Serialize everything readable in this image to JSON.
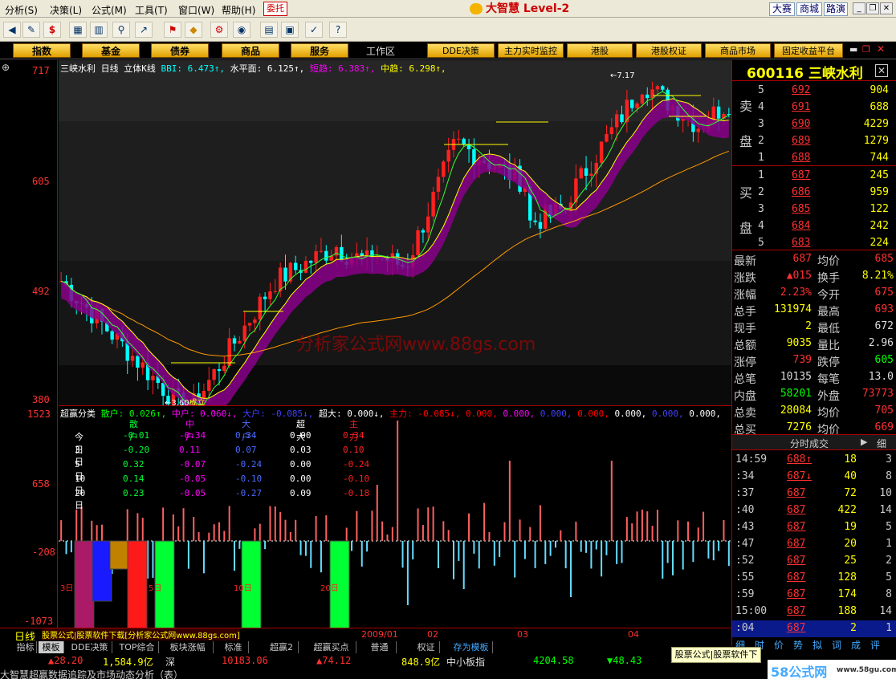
{
  "menu": [
    "分析(S)",
    "决策(L)",
    "公式(M)",
    "工具(T)",
    "窗口(W)",
    "帮助(H)"
  ],
  "menu_red": "委托",
  "brand": "大智慧 Level-2",
  "top_right": [
    "大赛",
    "商城",
    "路演"
  ],
  "toolbar_icons": [
    "mail-icon",
    "dollar-icon",
    "grid-icon",
    "chart-icon",
    "binoculars-icon",
    "bars-icon",
    "tag-icon",
    "diamond-icon",
    "gear-icon",
    "globe-icon",
    "doc-icon",
    "table-icon",
    "check-icon",
    "help-icon"
  ],
  "funcbar": {
    "tabs": [
      "指数",
      "基金",
      "债券",
      "商品",
      "服务"
    ],
    "workzone": "工作区",
    "tabs2": [
      "DDE决策",
      "主力实时监控",
      "港股",
      "港股权证",
      "商品市场",
      "固定收益平台"
    ]
  },
  "chart": {
    "title": "三峡水利",
    "period": "日线",
    "mode": "立体K线",
    "indicators": [
      {
        "label": "BBI: 6.473↑,",
        "color": "#00ffff"
      },
      {
        "label": "水平面: 6.125↑,",
        "color": "#ffffff"
      },
      {
        "label": "短趋: 6.383↑,",
        "color": "#ff00ff"
      },
      {
        "label": "中趋: 6.298↑,",
        "color": "#ffff00"
      }
    ],
    "ylabels": [
      "717",
      "605",
      "492",
      "380"
    ],
    "peak_label": "7.17",
    "low_label": "3.60",
    "low_suffix": "成立",
    "watermark": "分析家公式网www.88gs.com"
  },
  "sub": {
    "title": "超赢分类",
    "legend": [
      {
        "label": "散户: 0.026↑,",
        "color": "#00ff00"
      },
      {
        "label": "中户: 0.060↓,",
        "color": "#ff00ff"
      },
      {
        "label": "大户: -0.085↓,",
        "color": "#4040ff"
      },
      {
        "label": "超大: 0.000↓,",
        "color": "#ffffff"
      },
      {
        "label": "主力: -0.085↓,",
        "color": "#ff0000"
      },
      {
        "label": "0.000,",
        "color": "#ff0000"
      },
      {
        "label": "0.000,",
        "color": "#ff00ff"
      },
      {
        "label": "0.000,",
        "color": "#4040ff"
      },
      {
        "label": "0.000,",
        "color": "#ff0000"
      },
      {
        "label": "0.000,",
        "color": "#ffffff"
      },
      {
        "label": "0.000,",
        "color": "#4040ff"
      },
      {
        "label": "0.000,",
        "color": "#ffffff"
      }
    ],
    "ylabels": [
      "1523",
      "658",
      "-208",
      "-1073"
    ],
    "table_headers": [
      "散户",
      "中户",
      "大户",
      "超大",
      "主力"
    ],
    "table_rows": [
      {
        "label": "今日",
        "vals": [
          "-0.01",
          "-0.34",
          "0.34",
          "0.00",
          "0.34"
        ]
      },
      {
        "label": "3日",
        "vals": [
          "-0.20",
          "0.11",
          "0.07",
          "0.03",
          "0.10"
        ]
      },
      {
        "label": "5日",
        "vals": [
          "0.32",
          "-0.07",
          "-0.24",
          "0.00",
          "-0.24"
        ]
      },
      {
        "label": "10日",
        "vals": [
          "0.14",
          "-0.05",
          "-0.10",
          "0.00",
          "-0.10"
        ]
      },
      {
        "label": "20日",
        "vals": [
          "0.23",
          "-0.05",
          "-0.27",
          "0.09",
          "-0.18"
        ]
      }
    ],
    "group_labels": [
      "3日",
      "5日",
      "10日",
      "20日"
    ]
  },
  "xaxis": {
    "period": "日线",
    "ad": "股票公式|股票软件下载[分析家公式网www.88gs.com]",
    "dates": [
      "2009/01",
      "02",
      "03",
      "04"
    ]
  },
  "quote": {
    "code": "600116",
    "name": "三峡水利",
    "sell_label": [
      "卖",
      "盘"
    ],
    "buy_label": [
      "买",
      "盘"
    ],
    "sell": [
      {
        "lv": "5",
        "p": "692",
        "v": "904"
      },
      {
        "lv": "4",
        "p": "691",
        "v": "688"
      },
      {
        "lv": "3",
        "p": "690",
        "v": "4229"
      },
      {
        "lv": "2",
        "p": "689",
        "v": "1279"
      },
      {
        "lv": "1",
        "p": "688",
        "v": "744"
      }
    ],
    "buy": [
      {
        "lv": "1",
        "p": "687",
        "v": "245"
      },
      {
        "lv": "2",
        "p": "686",
        "v": "959"
      },
      {
        "lv": "3",
        "p": "685",
        "v": "122"
      },
      {
        "lv": "4",
        "p": "684",
        "v": "242"
      },
      {
        "lv": "5",
        "p": "683",
        "v": "224"
      }
    ],
    "info": [
      {
        "l1": "最新",
        "v1": "687",
        "c1": "#ff3030",
        "l2": "均价",
        "v2": "685",
        "c2": "#ff3030"
      },
      {
        "l1": "涨跌",
        "v1": "▲015",
        "c1": "#ff3030",
        "l2": "换手",
        "v2": "8.21%",
        "c2": "#ffff00"
      },
      {
        "l1": "涨幅",
        "v1": "2.23%",
        "c1": "#ff3030",
        "l2": "今开",
        "v2": "675",
        "c2": "#ff3030"
      },
      {
        "l1": "总手",
        "v1": "131974",
        "c1": "#ffff00",
        "l2": "最高",
        "v2": "693",
        "c2": "#ff3030"
      },
      {
        "l1": "现手",
        "v1": "2",
        "c1": "#ffff00",
        "l2": "最低",
        "v2": "672",
        "c2": "#dddddd"
      },
      {
        "l1": "总额",
        "v1": "9035",
        "c1": "#ffff00",
        "l2": "量比",
        "v2": "2.96",
        "c2": "#dddddd"
      },
      {
        "l1": "涨停",
        "v1": "739",
        "c1": "#ff3030",
        "l2": "跌停",
        "v2": "605",
        "c2": "#00ff00"
      },
      {
        "l1": "总笔",
        "v1": "10135",
        "c1": "#dddddd",
        "l2": "每笔",
        "v2": "13.0",
        "c2": "#dddddd"
      },
      {
        "l1": "内盘",
        "v1": "58201",
        "c1": "#00ff00",
        "l2": "外盘",
        "v2": "73773",
        "c2": "#ff3030"
      },
      {
        "l1": "总卖",
        "v1": "28084",
        "c1": "#ffff00",
        "l2": "均价",
        "v2": "705",
        "c2": "#ff3030"
      },
      {
        "l1": "总买",
        "v1": "7276",
        "c1": "#ffff00",
        "l2": "均价",
        "v2": "669",
        "c2": "#ff3030"
      }
    ],
    "ticks_title": "分时成交",
    "ticks_arrow": "▶",
    "ticks_side": "细",
    "ticks": [
      {
        "t": "14:59",
        "p": "688↑",
        "pc": "#ff3030",
        "v": "18",
        "n": "3"
      },
      {
        "t": ":34",
        "p": "687↓",
        "pc": "#ff3030",
        "v": "40",
        "n": "8"
      },
      {
        "t": ":37",
        "p": "687",
        "pc": "#ff3030",
        "v": "72",
        "n": "10"
      },
      {
        "t": ":40",
        "p": "687",
        "pc": "#ff3030",
        "v": "422",
        "n": "14"
      },
      {
        "t": ":43",
        "p": "687",
        "pc": "#ff3030",
        "v": "19",
        "n": "5"
      },
      {
        "t": ":47",
        "p": "687",
        "pc": "#ff3030",
        "v": "20",
        "n": "1"
      },
      {
        "t": ":52",
        "p": "687",
        "pc": "#ff3030",
        "v": "25",
        "n": "2"
      },
      {
        "t": ":55",
        "p": "687",
        "pc": "#ff3030",
        "v": "128",
        "n": "5"
      },
      {
        "t": ":59",
        "p": "687",
        "pc": "#ff3030",
        "v": "174",
        "n": "8"
      },
      {
        "t": "15:00",
        "p": "687",
        "pc": "#ff3030",
        "v": "188",
        "n": "14"
      },
      {
        "t": ":04",
        "p": "687",
        "pc": "#ff3030",
        "v": "2",
        "n": "1"
      }
    ],
    "bottom_tabs": [
      "细",
      "时",
      "价",
      "势",
      "拟",
      "词",
      "成",
      "评"
    ]
  },
  "tabs": [
    "指标",
    "模板",
    "DDE决策",
    "TOP综合",
    "板块涨幅",
    "标准",
    "超赢2",
    "超赢买点",
    "普通",
    "权证",
    "存为模板"
  ],
  "ticker": [
    {
      "text": "▲28.20",
      "color": "#ff3030"
    },
    {
      "text": "1,584.9亿",
      "color": "#ffff00"
    },
    {
      "text": "深",
      "color": "#dddddd"
    },
    {
      "text": "10183.06",
      "color": "#ff3030"
    },
    {
      "text": "▲74.12",
      "color": "#ff3030"
    },
    {
      "text": "848.9亿",
      "color": "#ffff00"
    },
    {
      "text": "中小板指",
      "color": "#dddddd"
    },
    {
      "text": "4204.58",
      "color": "#00ff00"
    },
    {
      "text": "▼48.43",
      "color": "#00ff00"
    }
  ],
  "adbox": "股票公式|股票软件下载",
  "status": "大智慧超赢数据追踪及市场动态分析（表）",
  "logo58": "58公式网",
  "logo58_url": "www.58gu.com"
}
